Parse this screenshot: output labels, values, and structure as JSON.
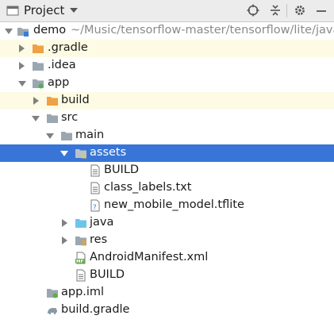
{
  "header": {
    "title": "Project",
    "icons": [
      "project-icon",
      "dropdown-arrow",
      "locate-icon",
      "collapse-all-icon",
      "settings-icon",
      "hide-icon"
    ]
  },
  "tree": {
    "rows": [
      {
        "label": "demo",
        "path": "~/Music/tensorflow-master/tensorflow/lite/java",
        "icon": "module-folder-icon",
        "expanded": true
      },
      {
        "label": ".gradle",
        "icon": "folder-orange-icon",
        "expanded": false
      },
      {
        "label": ".idea",
        "icon": "folder-gray-icon",
        "expanded": false
      },
      {
        "label": "app",
        "icon": "module-folder-icon",
        "expanded": true
      },
      {
        "label": "build",
        "icon": "folder-orange-icon",
        "expanded": false
      },
      {
        "label": "src",
        "icon": "folder-gray-icon",
        "expanded": true
      },
      {
        "label": "main",
        "icon": "folder-gray-icon",
        "expanded": true
      },
      {
        "label": "assets",
        "icon": "resources-folder-icon",
        "expanded": true,
        "selected": true
      },
      {
        "label": "BUILD",
        "icon": "text-file-icon"
      },
      {
        "label": "class_labels.txt",
        "icon": "text-file-icon"
      },
      {
        "label": "new_mobile_model.tflite",
        "icon": "unknown-file-icon"
      },
      {
        "label": "java",
        "icon": "source-folder-icon",
        "expanded": false
      },
      {
        "label": "res",
        "icon": "resources-folder-icon",
        "expanded": false
      },
      {
        "label": "AndroidManifest.xml",
        "icon": "manifest-file-icon"
      },
      {
        "label": "BUILD",
        "icon": "text-file-icon"
      },
      {
        "label": "app.iml",
        "icon": "iml-file-icon"
      },
      {
        "label": "build.gradle",
        "icon": "gradle-file-icon"
      }
    ]
  },
  "colors": {
    "header_bg": "#ececec",
    "selection": "#3875d7",
    "highlight_row": "#fdfbe3",
    "orange_folder": "#f0a045",
    "source_folder": "#6ec5ea"
  }
}
